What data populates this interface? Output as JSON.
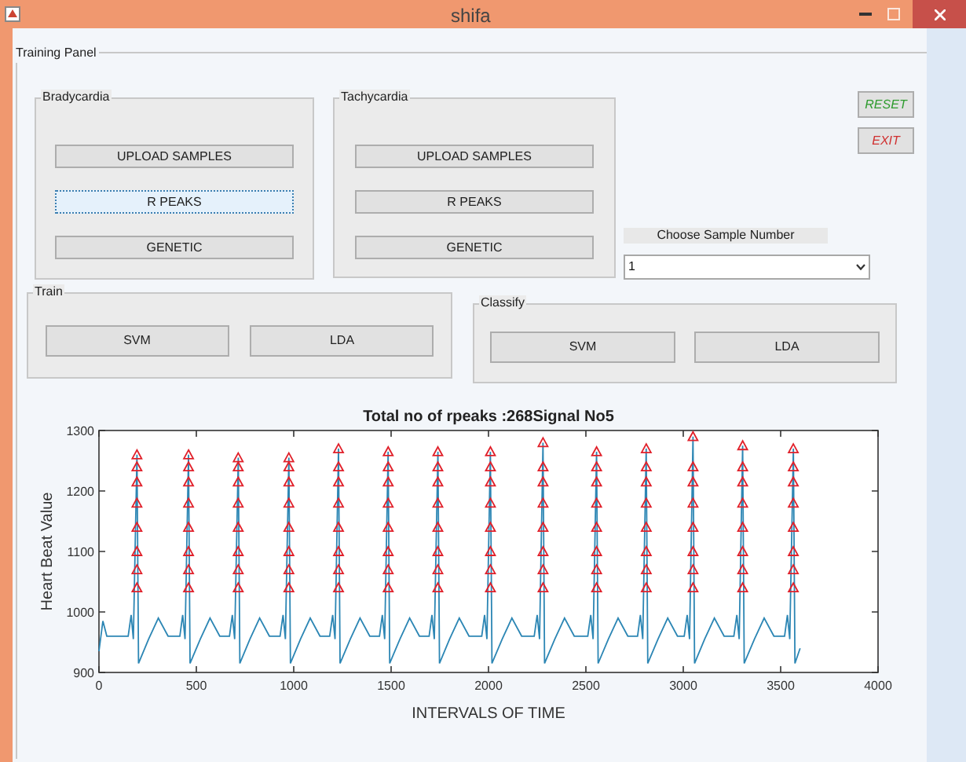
{
  "window": {
    "title": "shifa"
  },
  "training_panel": {
    "title": "Training Panel",
    "bradycardia": {
      "title": "Bradycardia",
      "buttons": [
        {
          "label": "UPLOAD SAMPLES",
          "focused": false
        },
        {
          "label": "R PEAKS",
          "focused": true
        },
        {
          "label": "GENETIC",
          "focused": false
        }
      ]
    },
    "tachycardia": {
      "title": "Tachycardia",
      "buttons": [
        {
          "label": "UPLOAD SAMPLES",
          "focused": false
        },
        {
          "label": "R PEAKS",
          "focused": false
        },
        {
          "label": "GENETIC",
          "focused": false
        }
      ]
    },
    "actions": [
      {
        "label": "RESET",
        "kind": "reset"
      },
      {
        "label": "EXIT",
        "kind": "exit"
      }
    ],
    "sample": {
      "label": "Choose Sample Number",
      "value": "1"
    },
    "train": {
      "title": "Train",
      "buttons": [
        {
          "label": "SVM",
          "focused": false
        },
        {
          "label": "LDA",
          "focused": false
        }
      ]
    },
    "classify": {
      "title": "Classify",
      "buttons": [
        {
          "label": "SVM",
          "focused": false
        },
        {
          "label": "LDA",
          "focused": false
        }
      ]
    },
    "chart": {
      "chart_data": {
        "type": "line",
        "title": "Total no of rpeaks :268Signal No5",
        "xlabel": "INTERVALS OF TIME",
        "ylabel": "Heart Beat Value",
        "xlim": [
          0,
          4000
        ],
        "ylim": [
          900,
          1300
        ],
        "xticks": [
          0,
          500,
          1000,
          1500,
          2000,
          2500,
          3000,
          3500,
          4000
        ],
        "yticks": [
          900,
          1000,
          1100,
          1200,
          1300
        ],
        "series": [
          {
            "color": "#2c86b4",
            "x": [
              0,
              20,
              40,
              150,
              165,
              177,
              195,
              203,
              255,
              305,
              355,
              415,
              430,
              442,
              460,
              468,
              520,
              570,
              620,
              670,
              685,
              697,
              715,
              723,
              775,
              825,
              875,
              930,
              945,
              957,
              975,
              983,
              1035,
              1085,
              1135,
              1185,
              1200,
              1212,
              1230,
              1238,
              1290,
              1340,
              1390,
              1440,
              1455,
              1467,
              1485,
              1493,
              1545,
              1595,
              1645,
              1695,
              1710,
              1722,
              1740,
              1748,
              1800,
              1850,
              1900,
              1965,
              1980,
              1992,
              2010,
              2018,
              2070,
              2120,
              2170,
              2235,
              2250,
              2262,
              2280,
              2288,
              2340,
              2390,
              2440,
              2510,
              2525,
              2537,
              2555,
              2563,
              2615,
              2665,
              2715,
              2765,
              2780,
              2792,
              2810,
              2818,
              2870,
              2920,
              2970,
              3005,
              3020,
              3032,
              3050,
              3058,
              3110,
              3160,
              3210,
              3260,
              3275,
              3287,
              3305,
              3313,
              3365,
              3415,
              3465,
              3520,
              3535,
              3547,
              3565,
              3573,
              3600
            ],
            "values": [
              935,
              985,
              960,
              960,
              995,
              955,
              1260,
              915,
              955,
              990,
              960,
              960,
              995,
              955,
              1260,
              915,
              955,
              990,
              960,
              960,
              995,
              955,
              1255,
              915,
              955,
              990,
              960,
              960,
              995,
              955,
              1255,
              915,
              955,
              990,
              960,
              960,
              995,
              955,
              1270,
              915,
              955,
              990,
              960,
              960,
              995,
              955,
              1265,
              915,
              955,
              990,
              960,
              960,
              995,
              955,
              1265,
              915,
              955,
              990,
              960,
              960,
              995,
              955,
              1265,
              915,
              955,
              990,
              960,
              960,
              995,
              955,
              1280,
              915,
              955,
              990,
              960,
              960,
              995,
              955,
              1265,
              915,
              955,
              990,
              960,
              960,
              995,
              955,
              1270,
              915,
              955,
              990,
              960,
              960,
              995,
              955,
              1290,
              915,
              955,
              990,
              960,
              960,
              995,
              955,
              1275,
              915,
              955,
              990,
              960,
              960,
              995,
              955,
              1270,
              915,
              940
            ]
          },
          {
            "type": "scatter",
            "color": "#e0202a",
            "x": [
              195,
              195,
              195,
              195,
              195,
              195,
              195,
              195,
              460,
              460,
              460,
              460,
              460,
              460,
              460,
              460,
              715,
              715,
              715,
              715,
              715,
              715,
              715,
              715,
              975,
              975,
              975,
              975,
              975,
              975,
              975,
              975,
              1230,
              1230,
              1230,
              1230,
              1230,
              1230,
              1230,
              1230,
              1485,
              1485,
              1485,
              1485,
              1485,
              1485,
              1485,
              1485,
              1740,
              1740,
              1740,
              1740,
              1740,
              1740,
              1740,
              1740,
              2010,
              2010,
              2010,
              2010,
              2010,
              2010,
              2010,
              2010,
              2280,
              2280,
              2280,
              2280,
              2280,
              2280,
              2280,
              2280,
              2555,
              2555,
              2555,
              2555,
              2555,
              2555,
              2555,
              2555,
              2810,
              2810,
              2810,
              2810,
              2810,
              2810,
              2810,
              2810,
              3050,
              3050,
              3050,
              3050,
              3050,
              3050,
              3050,
              3050,
              3305,
              3305,
              3305,
              3305,
              3305,
              3305,
              3305,
              3305,
              3565,
              3565,
              3565,
              3565,
              3565,
              3565,
              3565,
              3565
            ],
            "values": [
              1040,
              1070,
              1100,
              1140,
              1180,
              1215,
              1240,
              1260,
              1040,
              1070,
              1100,
              1140,
              1180,
              1215,
              1240,
              1260,
              1040,
              1070,
              1100,
              1140,
              1180,
              1215,
              1240,
              1255,
              1040,
              1070,
              1100,
              1140,
              1180,
              1215,
              1240,
              1255,
              1040,
              1070,
              1100,
              1140,
              1180,
              1215,
              1240,
              1270,
              1040,
              1070,
              1100,
              1140,
              1180,
              1215,
              1240,
              1265,
              1040,
              1070,
              1100,
              1140,
              1180,
              1215,
              1240,
              1265,
              1040,
              1070,
              1100,
              1140,
              1180,
              1215,
              1240,
              1265,
              1040,
              1070,
              1100,
              1140,
              1180,
              1215,
              1240,
              1280,
              1040,
              1070,
              1100,
              1140,
              1180,
              1215,
              1240,
              1265,
              1040,
              1070,
              1100,
              1140,
              1180,
              1215,
              1240,
              1270,
              1040,
              1070,
              1100,
              1140,
              1180,
              1215,
              1240,
              1290,
              1040,
              1070,
              1100,
              1140,
              1180,
              1215,
              1240,
              1275,
              1040,
              1070,
              1100,
              1140,
              1180,
              1215,
              1240,
              1270
            ]
          }
        ]
      }
    }
  }
}
